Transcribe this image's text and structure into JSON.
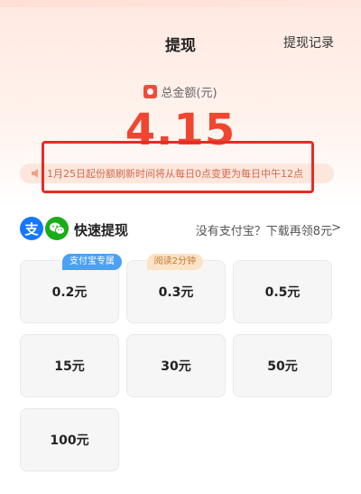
{
  "header": {
    "title": "提现",
    "record_link": "提现记录"
  },
  "balance": {
    "label": "总金额(元)",
    "amount": "4.15"
  },
  "notice": {
    "text": "1月25日起份额刷新时间将从每日0点变更为每日中午12点"
  },
  "section": {
    "title": "快速提现",
    "download_prompt": "没有支付宝？下载再领8元",
    "chevron": ">",
    "alipay_glyph": "支"
  },
  "tiles": [
    {
      "label": "0.2元",
      "tag": "支付宝专属"
    },
    {
      "label": "0.3元",
      "tag": "阅读2分钟"
    },
    {
      "label": "0.5元"
    },
    {
      "label": "15元"
    },
    {
      "label": "30元"
    },
    {
      "label": "50元"
    },
    {
      "label": "100元"
    }
  ],
  "colors": {
    "accent_red": "#f0452f",
    "alipay_blue": "#1677ff",
    "wechat_green": "#1aad19",
    "tag_blue": "#4ca0f5"
  }
}
